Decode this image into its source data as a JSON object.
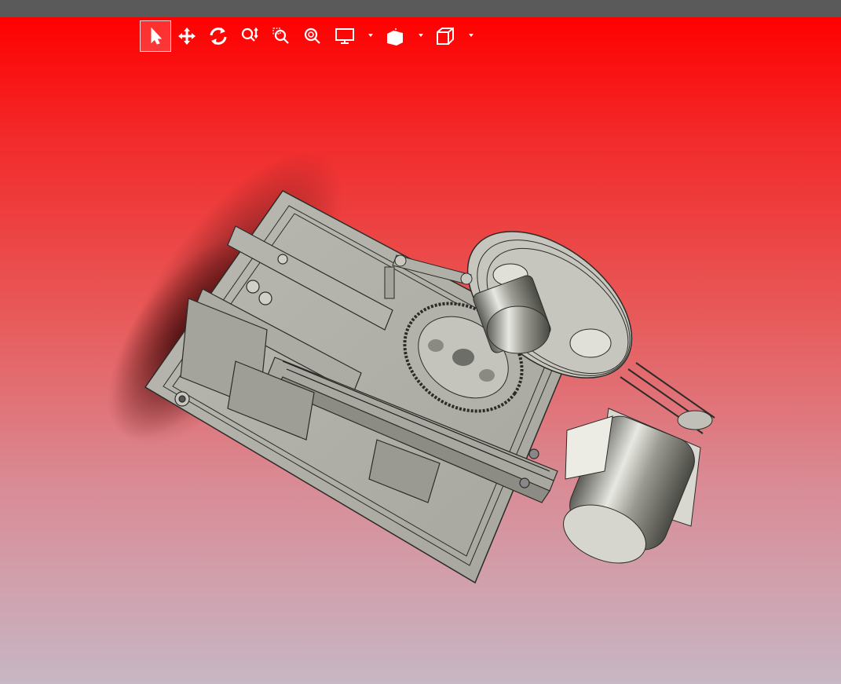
{
  "window": {
    "title_bar_color": "#5a5a5a"
  },
  "viewport": {
    "background_top": "#ff0000",
    "background_bottom": "#c7b6c4"
  },
  "toolbar": {
    "buttons": [
      {
        "name": "select",
        "icon": "select-arrow-icon",
        "active": true
      },
      {
        "name": "pan",
        "icon": "pan-move-icon"
      },
      {
        "name": "rotate",
        "icon": "rotate-icon"
      },
      {
        "name": "zoom",
        "icon": "zoom-updown-icon"
      },
      {
        "name": "zoom-window",
        "icon": "zoom-window-icon"
      },
      {
        "name": "zoom-fit",
        "icon": "zoom-fit-icon"
      },
      {
        "name": "display",
        "icon": "display-monitor-icon",
        "dropdown": true
      },
      {
        "name": "section",
        "icon": "section-view-icon",
        "dropdown": true
      },
      {
        "name": "view-orientation",
        "icon": "cube-view-icon",
        "dropdown": true
      }
    ]
  },
  "model": {
    "description_icon": "mechanical-assembly-3d",
    "colors": {
      "metal": "#b8b8b0",
      "metal_dark": "#6e6e68",
      "shadow": "#3a0d0d"
    }
  }
}
